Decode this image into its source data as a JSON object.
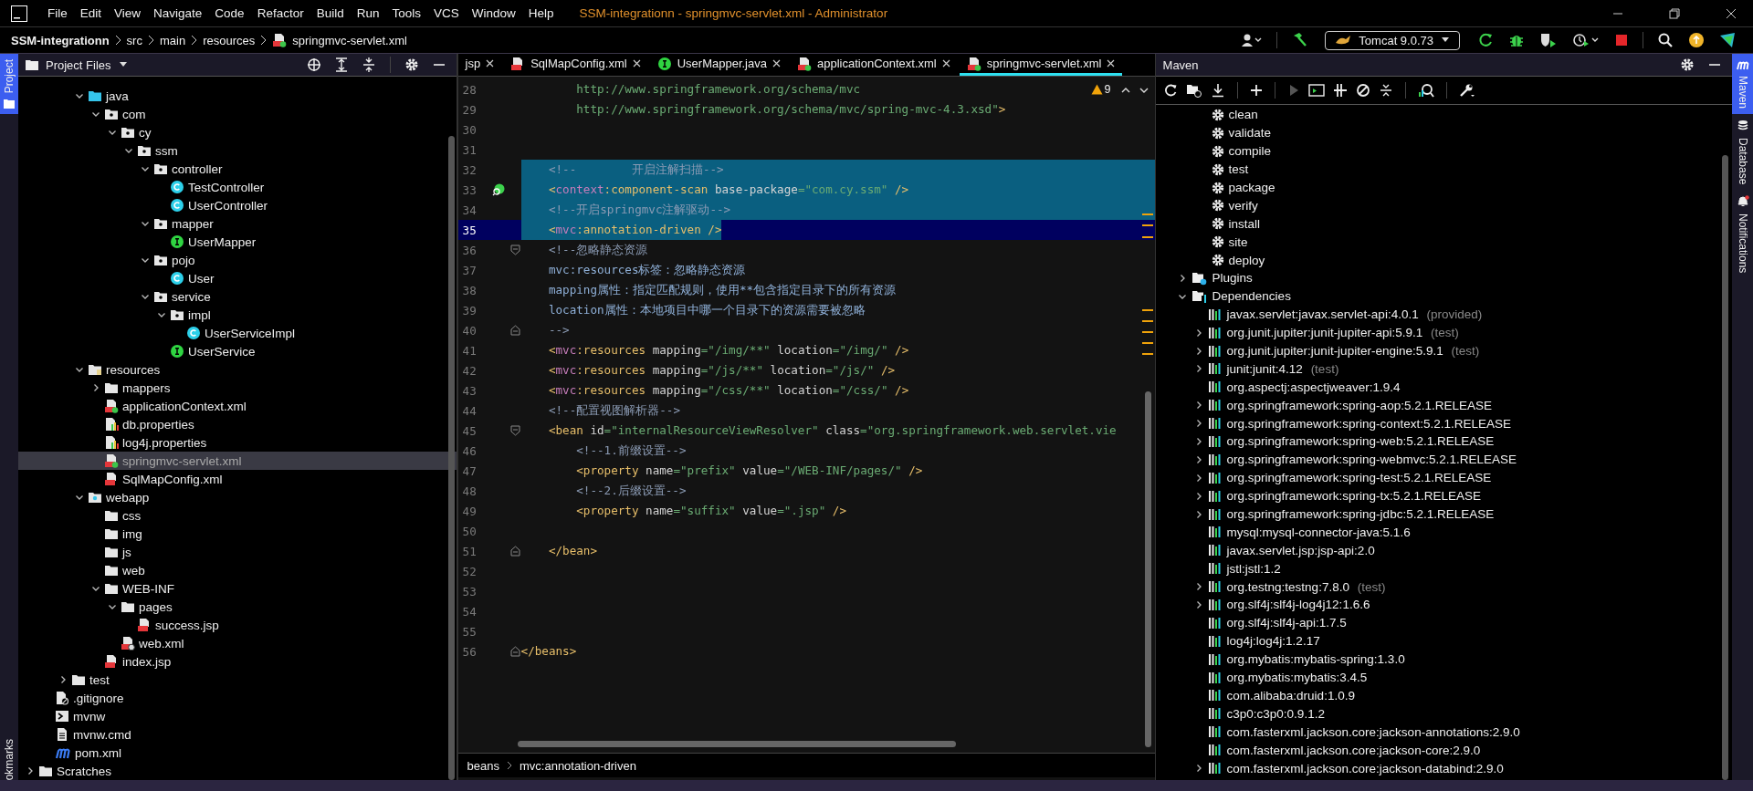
{
  "window": {
    "title": "SSM-integrationn - springmvc-servlet.xml - Administrator"
  },
  "menu": [
    "File",
    "Edit",
    "View",
    "Navigate",
    "Code",
    "Refactor",
    "Build",
    "Run",
    "Tools",
    "VCS",
    "Window",
    "Help"
  ],
  "breadcrumbs": [
    {
      "label": "SSM-integrationn",
      "kind": "project"
    },
    {
      "label": "src",
      "kind": "dir"
    },
    {
      "label": "main",
      "kind": "dir"
    },
    {
      "label": "resources",
      "kind": "dir"
    },
    {
      "label": "springmvc-servlet.xml",
      "kind": "spring-xml"
    }
  ],
  "run_config": {
    "label": "Tomcat 9.0.73"
  },
  "left_stripe": [
    {
      "label": "Project",
      "selected": true
    },
    {
      "label": "okmarks",
      "selected": false
    }
  ],
  "project": {
    "title": "Project Files",
    "tree": {
      "under_main": [
        {
          "label": "java",
          "kind": "source-folder",
          "expanded": true,
          "selected": false,
          "children": [
            {
              "label": "com",
              "kind": "package",
              "expanded": true,
              "selected": false,
              "children": [
                {
                  "label": "cy",
                  "kind": "package",
                  "expanded": true,
                  "selected": false,
                  "children": [
                    {
                      "label": "ssm",
                      "kind": "package",
                      "expanded": true,
                      "selected": false,
                      "children": [
                        {
                          "label": "controller",
                          "kind": "package",
                          "expanded": true,
                          "selected": false,
                          "children": [
                            {
                              "label": "TestController",
                              "kind": "class",
                              "selected": false
                            },
                            {
                              "label": "UserController",
                              "kind": "class",
                              "selected": false
                            }
                          ]
                        },
                        {
                          "label": "mapper",
                          "kind": "package",
                          "expanded": true,
                          "selected": false,
                          "children": [
                            {
                              "label": "UserMapper",
                              "kind": "interface",
                              "selected": false
                            }
                          ]
                        },
                        {
                          "label": "pojo",
                          "kind": "package",
                          "expanded": true,
                          "selected": false,
                          "children": [
                            {
                              "label": "User",
                              "kind": "class",
                              "selected": false
                            }
                          ]
                        },
                        {
                          "label": "service",
                          "kind": "package",
                          "expanded": true,
                          "selected": false,
                          "children": [
                            {
                              "label": "impl",
                              "kind": "package",
                              "expanded": true,
                              "selected": false,
                              "children": [
                                {
                                  "label": "UserServiceImpl",
                                  "kind": "class",
                                  "selected": false
                                }
                              ]
                            },
                            {
                              "label": "UserService",
                              "kind": "interface",
                              "selected": false
                            }
                          ]
                        }
                      ]
                    }
                  ]
                }
              ]
            }
          ]
        },
        {
          "label": "resources",
          "kind": "resources-folder",
          "expanded": true,
          "selected": false,
          "children": [
            {
              "label": "mappers",
              "kind": "folder",
              "expanded": false,
              "selected": false
            },
            {
              "label": "applicationContext.xml",
              "kind": "spring-xml",
              "selected": false
            },
            {
              "label": "db.properties",
              "kind": "properties",
              "selected": false
            },
            {
              "label": "log4j.properties",
              "kind": "properties",
              "selected": false
            },
            {
              "label": "springmvc-servlet.xml",
              "kind": "spring-xml",
              "selected": true
            },
            {
              "label": "SqlMapConfig.xml",
              "kind": "xml",
              "selected": false
            }
          ]
        },
        {
          "label": "webapp",
          "kind": "web-folder",
          "expanded": true,
          "selected": false,
          "children": [
            {
              "label": "css",
              "kind": "folder",
              "selected": false
            },
            {
              "label": "img",
              "kind": "folder",
              "selected": false
            },
            {
              "label": "js",
              "kind": "folder",
              "selected": false
            },
            {
              "label": "web",
              "kind": "folder",
              "selected": false
            },
            {
              "label": "WEB-INF",
              "kind": "folder",
              "expanded": true,
              "selected": false,
              "children": [
                {
                  "label": "pages",
                  "kind": "folder",
                  "expanded": true,
                  "selected": false,
                  "children": [
                    {
                      "label": "success.jsp",
                      "kind": "jsp",
                      "selected": false
                    }
                  ]
                },
                {
                  "label": "web.xml",
                  "kind": "web-xml",
                  "selected": false
                }
              ]
            },
            {
              "label": "index.jsp",
              "kind": "jsp",
              "selected": false
            }
          ]
        }
      ],
      "under_src": [
        {
          "label": "test",
          "kind": "folder",
          "expanded": false,
          "selected": false
        }
      ],
      "under_project": [
        {
          "label": ".gitignore",
          "kind": "gitignore",
          "selected": false
        },
        {
          "label": "mvnw",
          "kind": "script",
          "selected": false
        },
        {
          "label": "mvnw.cmd",
          "kind": "text",
          "selected": false
        },
        {
          "label": "pom.xml",
          "kind": "maven",
          "selected": false
        }
      ],
      "top_level": [
        {
          "label": "Scratches",
          "kind": "folder",
          "expanded": false,
          "selected": false
        }
      ]
    }
  },
  "editor": {
    "tabs": [
      {
        "label": "jsp",
        "kind": "cut",
        "selected": false
      },
      {
        "label": "SqlMapConfig.xml",
        "kind": "xml",
        "selected": false
      },
      {
        "label": "UserMapper.java",
        "kind": "interface",
        "selected": false
      },
      {
        "label": "applicationContext.xml",
        "kind": "spring-xml",
        "selected": false
      },
      {
        "label": "springmvc-servlet.xml",
        "kind": "spring-xml",
        "selected": true
      }
    ],
    "warnings": "9",
    "lines": [
      {
        "number": "28",
        "selected": false,
        "current": false,
        "tokens": [
          {
            "text": "        http://www.springframework.org/schema/mvc",
            "kind": "value"
          }
        ]
      },
      {
        "number": "29",
        "selected": false,
        "current": false,
        "tokens": [
          {
            "text": "        http://www.springframework.org/schema/mvc/spring-mvc-4.3.xsd\"",
            "kind": "value"
          },
          {
            "text": ">",
            "kind": "tag"
          }
        ]
      },
      {
        "number": "30",
        "selected": false,
        "current": false
      },
      {
        "number": "31",
        "selected": false,
        "current": false
      },
      {
        "number": "32",
        "selected": true,
        "current": false,
        "tokens": [
          {
            "text": "    <!--        开启注解扫描-->",
            "kind": "comment"
          }
        ]
      },
      {
        "number": "33",
        "selected": true,
        "current": false,
        "bean": true,
        "tokens": [
          {
            "text": "    <",
            "kind": "tag"
          },
          {
            "text": "context",
            "kind": "ns"
          },
          {
            "text": ":component-scan",
            "kind": "tag"
          },
          {
            "text": " base-package",
            "kind": "attr"
          },
          {
            "text": "=\"com.cy.ssm\"",
            "kind": "value"
          },
          {
            "text": " />",
            "kind": "tag"
          }
        ]
      },
      {
        "number": "34",
        "selected": true,
        "current": false,
        "tokens": [
          {
            "text": "    <!--开启springmvc注解驱动-->",
            "kind": "comment"
          }
        ]
      },
      {
        "number": "35",
        "selected": true,
        "current": true,
        "tokens": [
          {
            "text": "    <",
            "kind": "tag"
          },
          {
            "text": "mvc",
            "kind": "ns"
          },
          {
            "text": ":annotation-driven />",
            "kind": "tag"
          }
        ]
      },
      {
        "number": "36",
        "selected": false,
        "current": false,
        "fold_start": true,
        "tokens": [
          {
            "text": "    <!--忽略静态资源",
            "kind": "comment"
          }
        ]
      },
      {
        "number": "37",
        "selected": false,
        "current": false,
        "tokens": [
          {
            "text": "    mvc:resources标签：忽略静态资源",
            "kind": "doc"
          }
        ]
      },
      {
        "number": "38",
        "selected": false,
        "current": false,
        "tokens": [
          {
            "text": "    mapping属性：指定匹配规则，使用**包含指定目录下的所有资源",
            "kind": "doc"
          }
        ]
      },
      {
        "number": "39",
        "selected": false,
        "current": false,
        "tokens": [
          {
            "text": "    location属性：本地项目中哪一个目录下的资源需要被忽略",
            "kind": "doc"
          }
        ]
      },
      {
        "number": "40",
        "selected": false,
        "current": false,
        "fold_end": true,
        "tokens": [
          {
            "text": "    -->",
            "kind": "comment"
          }
        ]
      },
      {
        "number": "41",
        "selected": false,
        "current": false,
        "tokens": [
          {
            "text": "    <",
            "kind": "tag"
          },
          {
            "text": "mvc",
            "kind": "ns"
          },
          {
            "text": ":resources",
            "kind": "tag"
          },
          {
            "text": " mapping",
            "kind": "attr"
          },
          {
            "text": "=\"/img/**\"",
            "kind": "value"
          },
          {
            "text": " location",
            "kind": "attr"
          },
          {
            "text": "=\"/img/\"",
            "kind": "value"
          },
          {
            "text": " />",
            "kind": "tag"
          }
        ]
      },
      {
        "number": "42",
        "selected": false,
        "current": false,
        "tokens": [
          {
            "text": "    <",
            "kind": "tag"
          },
          {
            "text": "mvc",
            "kind": "ns"
          },
          {
            "text": ":resources",
            "kind": "tag"
          },
          {
            "text": " mapping",
            "kind": "attr"
          },
          {
            "text": "=\"/js/**\"",
            "kind": "value"
          },
          {
            "text": " location",
            "kind": "attr"
          },
          {
            "text": "=\"/js/\"",
            "kind": "value"
          },
          {
            "text": " />",
            "kind": "tag"
          }
        ]
      },
      {
        "number": "43",
        "selected": false,
        "current": false,
        "tokens": [
          {
            "text": "    <",
            "kind": "tag"
          },
          {
            "text": "mvc",
            "kind": "ns"
          },
          {
            "text": ":resources",
            "kind": "tag"
          },
          {
            "text": " mapping",
            "kind": "attr"
          },
          {
            "text": "=\"/css/**\"",
            "kind": "value"
          },
          {
            "text": " location",
            "kind": "attr"
          },
          {
            "text": "=\"/css/\"",
            "kind": "value"
          },
          {
            "text": " />",
            "kind": "tag"
          }
        ]
      },
      {
        "number": "44",
        "selected": false,
        "current": false,
        "tokens": [
          {
            "text": "    <!--配置视图解析器-->",
            "kind": "comment"
          }
        ]
      },
      {
        "number": "45",
        "selected": false,
        "current": false,
        "fold_start": true,
        "tokens": [
          {
            "text": "    <bean",
            "kind": "tag"
          },
          {
            "text": " id",
            "kind": "attr"
          },
          {
            "text": "=\"internalResourceViewResolver\"",
            "kind": "value"
          },
          {
            "text": " class",
            "kind": "attr"
          },
          {
            "text": "=\"org.springframework.web.servlet.vie",
            "kind": "value"
          }
        ]
      },
      {
        "number": "46",
        "selected": false,
        "current": false,
        "tokens": [
          {
            "text": "        <!--1.前缀设置-->",
            "kind": "comment"
          }
        ]
      },
      {
        "number": "47",
        "selected": false,
        "current": false,
        "tokens": [
          {
            "text": "        <property",
            "kind": "tag"
          },
          {
            "text": " name",
            "kind": "attr"
          },
          {
            "text": "=\"prefix\"",
            "kind": "value"
          },
          {
            "text": " value",
            "kind": "attr"
          },
          {
            "text": "=\"/WEB-INF/pages/\"",
            "kind": "value"
          },
          {
            "text": " />",
            "kind": "tag"
          }
        ]
      },
      {
        "number": "48",
        "selected": false,
        "current": false,
        "tokens": [
          {
            "text": "        <!--2.后缀设置-->",
            "kind": "comment"
          }
        ]
      },
      {
        "number": "49",
        "selected": false,
        "current": false,
        "tokens": [
          {
            "text": "        <property",
            "kind": "tag"
          },
          {
            "text": " name",
            "kind": "attr"
          },
          {
            "text": "=\"suffix\"",
            "kind": "value"
          },
          {
            "text": " value",
            "kind": "attr"
          },
          {
            "text": "=\".jsp\"",
            "kind": "value"
          },
          {
            "text": " />",
            "kind": "tag"
          }
        ]
      },
      {
        "number": "50",
        "selected": false,
        "current": false
      },
      {
        "number": "51",
        "selected": false,
        "current": false,
        "fold_end": true,
        "tokens": [
          {
            "text": "    </bean>",
            "kind": "tag"
          }
        ]
      },
      {
        "number": "52",
        "selected": false,
        "current": false
      },
      {
        "number": "53",
        "selected": false,
        "current": false
      },
      {
        "number": "54",
        "selected": false,
        "current": false
      },
      {
        "number": "55",
        "selected": false,
        "current": false
      },
      {
        "number": "56",
        "selected": false,
        "current": false,
        "fold_end": true,
        "tokens": [
          {
            "text": "</beans>",
            "kind": "tag"
          }
        ]
      }
    ],
    "breadcrumbs": [
      "beans",
      "mvc:annotation-driven"
    ]
  },
  "maven": {
    "title": "Maven",
    "goals": [
      "clean",
      "validate",
      "compile",
      "test",
      "package",
      "verify",
      "install",
      "site",
      "deploy"
    ],
    "nodes": [
      {
        "label": "Plugins",
        "kind": "plugins",
        "expanded": false
      },
      {
        "label": "Dependencies",
        "kind": "dependencies",
        "expanded": true,
        "children": [
          {
            "label": "javax.servlet:javax.servlet-api:4.0.1",
            "scope": "(provided)"
          },
          {
            "label": "org.junit.jupiter:junit-jupiter-api:5.9.1",
            "scope": "(test)",
            "expanded": false
          },
          {
            "label": "org.junit.jupiter:junit-jupiter-engine:5.9.1",
            "scope": "(test)",
            "expanded": false
          },
          {
            "label": "junit:junit:4.12",
            "scope": "(test)",
            "expanded": false
          },
          {
            "label": "org.aspectj:aspectjweaver:1.9.4"
          },
          {
            "label": "org.springframework:spring-aop:5.2.1.RELEASE",
            "expanded": false
          },
          {
            "label": "org.springframework:spring-context:5.2.1.RELEASE",
            "expanded": false
          },
          {
            "label": "org.springframework:spring-web:5.2.1.RELEASE",
            "expanded": false
          },
          {
            "label": "org.springframework:spring-webmvc:5.2.1.RELEASE",
            "expanded": false
          },
          {
            "label": "org.springframework:spring-test:5.2.1.RELEASE",
            "expanded": false
          },
          {
            "label": "org.springframework:spring-tx:5.2.1.RELEASE",
            "expanded": false
          },
          {
            "label": "org.springframework:spring-jdbc:5.2.1.RELEASE",
            "expanded": false
          },
          {
            "label": "mysql:mysql-connector-java:5.1.6"
          },
          {
            "label": "javax.servlet.jsp:jsp-api:2.0"
          },
          {
            "label": "jstl:jstl:1.2"
          },
          {
            "label": "org.testng:testng:7.8.0",
            "scope": "(test)",
            "expanded": false
          },
          {
            "label": "org.slf4j:slf4j-log4j12:1.6.6",
            "expanded": false
          },
          {
            "label": "org.slf4j:slf4j-api:1.7.5"
          },
          {
            "label": "log4j:log4j:1.2.17"
          },
          {
            "label": "org.mybatis:mybatis-spring:1.3.0"
          },
          {
            "label": "org.mybatis:mybatis:3.4.5"
          },
          {
            "label": "com.alibaba:druid:1.0.9"
          },
          {
            "label": "c3p0:c3p0:0.9.1.2"
          },
          {
            "label": "com.fasterxml.jackson.core:jackson-annotations:2.9.0"
          },
          {
            "label": "com.fasterxml.jackson.core:jackson-core:2.9.0"
          },
          {
            "label": "com.fasterxml.jackson.core:jackson-databind:2.9.0",
            "expanded": false
          }
        ]
      }
    ]
  },
  "right_stripe": [
    {
      "label": "Maven",
      "kind": "maven",
      "selected": true
    },
    {
      "label": "Database",
      "kind": "database",
      "selected": false
    },
    {
      "label": "Notifications",
      "kind": "notifications",
      "selected": false
    }
  ]
}
